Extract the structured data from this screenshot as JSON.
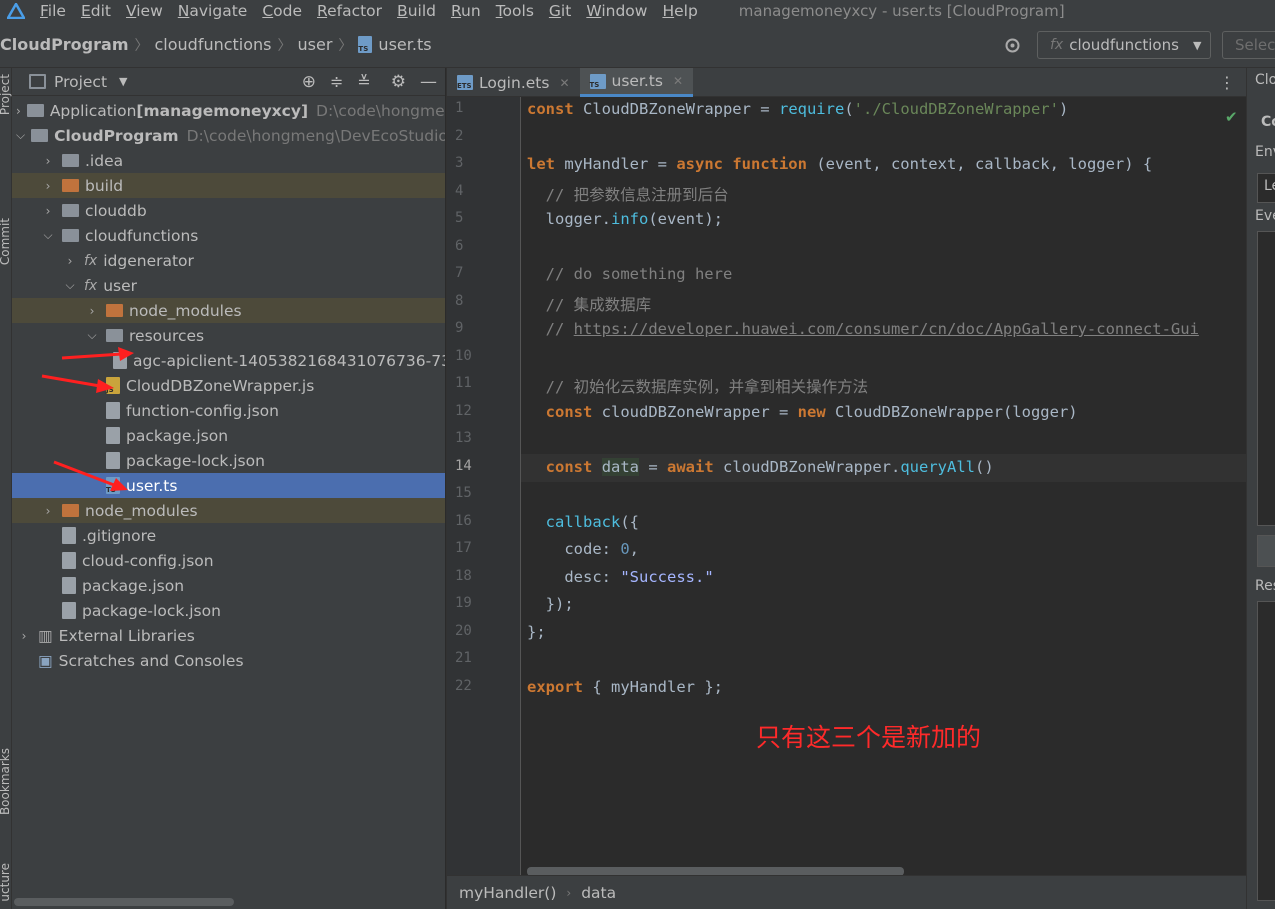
{
  "menubar": {
    "items": [
      "File",
      "Edit",
      "View",
      "Navigate",
      "Code",
      "Refactor",
      "Build",
      "Run",
      "Tools",
      "Git",
      "Window",
      "Help"
    ],
    "underline": [
      "F",
      "E",
      "V",
      "N",
      "C",
      "R",
      "B",
      "R",
      "T",
      "G",
      "W",
      "H"
    ],
    "window_title": "managemoneyxcy - user.ts [CloudProgram]"
  },
  "breadcrumb": {
    "items": [
      "CloudProgram",
      "cloudfunctions",
      "user",
      "user.ts"
    ]
  },
  "toolbar": {
    "run_config": "cloudfunctions",
    "select_placeholder": "Selec"
  },
  "left_strip": {
    "project": "Project",
    "commit": "Commit",
    "bookmarks": "Bookmarks",
    "structure": "ucture"
  },
  "project_panel": {
    "title": "Project",
    "tree": [
      {
        "indent": 0,
        "arrow": "›",
        "icon": "module",
        "name": "Application",
        "bold_suffix": "[managemoneyxcy]",
        "path": "D:\\code\\hongmen"
      },
      {
        "indent": 0,
        "arrow": "⌄",
        "icon": "module",
        "name": "CloudProgram",
        "path": "D:\\code\\hongmeng\\DevEcoStudioP",
        "bold": true
      },
      {
        "indent": 1,
        "arrow": "›",
        "icon": "folder",
        "name": ".idea"
      },
      {
        "indent": 1,
        "arrow": "›",
        "icon": "folder-orange",
        "name": "build",
        "hl": true
      },
      {
        "indent": 1,
        "arrow": "›",
        "icon": "folder",
        "name": "clouddb"
      },
      {
        "indent": 1,
        "arrow": "⌄",
        "icon": "folder",
        "name": "cloudfunctions"
      },
      {
        "indent": 2,
        "arrow": "›",
        "icon": "fx",
        "name": "idgenerator"
      },
      {
        "indent": 2,
        "arrow": "⌄",
        "icon": "fx",
        "name": "user"
      },
      {
        "indent": 3,
        "arrow": "›",
        "icon": "folder-orange",
        "name": "node_modules",
        "hl": true
      },
      {
        "indent": 3,
        "arrow": "⌄",
        "icon": "folder",
        "name": "resources"
      },
      {
        "indent": 4,
        "arrow": "",
        "icon": "file",
        "name": "agc-apiclient-1405382168431076736-73"
      },
      {
        "indent": 3,
        "arrow": "",
        "icon": "file-js",
        "name": "CloudDBZoneWrapper.js"
      },
      {
        "indent": 3,
        "arrow": "",
        "icon": "file",
        "name": "function-config.json"
      },
      {
        "indent": 3,
        "arrow": "",
        "icon": "file",
        "name": "package.json"
      },
      {
        "indent": 3,
        "arrow": "",
        "icon": "file",
        "name": "package-lock.json"
      },
      {
        "indent": 3,
        "arrow": "",
        "icon": "file-ts",
        "name": "user.ts",
        "selected": true
      },
      {
        "indent": 1,
        "arrow": "›",
        "icon": "folder-orange",
        "name": "node_modules",
        "hl": true
      },
      {
        "indent": 1,
        "arrow": "",
        "icon": "file",
        "name": ".gitignore"
      },
      {
        "indent": 1,
        "arrow": "",
        "icon": "file",
        "name": "cloud-config.json"
      },
      {
        "indent": 1,
        "arrow": "",
        "icon": "file",
        "name": "package.json"
      },
      {
        "indent": 1,
        "arrow": "",
        "icon": "file",
        "name": "package-lock.json"
      },
      {
        "indent": 0,
        "arrow": "›",
        "icon": "library",
        "name": "External Libraries"
      },
      {
        "indent": 0,
        "arrow": "",
        "icon": "scratch",
        "name": "Scratches and Consoles"
      }
    ]
  },
  "editor": {
    "tabs": [
      {
        "label": "Login.ets",
        "icon": "ets",
        "active": false
      },
      {
        "label": "user.ts",
        "icon": "ts",
        "active": true
      }
    ],
    "line_numbers": [
      "1",
      "2",
      "3",
      "4",
      "5",
      "6",
      "7",
      "8",
      "9",
      "10",
      "11",
      "12",
      "13",
      "14",
      "15",
      "16",
      "17",
      "18",
      "19",
      "20",
      "21",
      "22"
    ],
    "annotation": "只有这三个是新加的",
    "status_crumbs": [
      "myHandler()",
      "data"
    ]
  },
  "right_panel": {
    "labels": [
      "Clo",
      "Co",
      "Env",
      "Le",
      "Eve",
      "Res"
    ]
  },
  "colors": {
    "accent": "#4a88c7",
    "selected_row": "#4b6eaf",
    "annotation_red": "#ff2a2a"
  }
}
